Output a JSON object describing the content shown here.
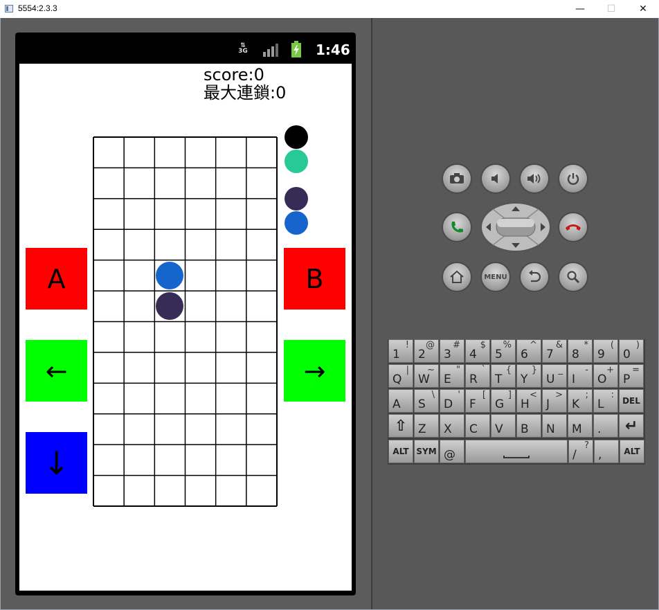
{
  "window": {
    "title": "5554:2.3.3",
    "minimize": "—",
    "maximize": "☐",
    "close": "✕"
  },
  "statusbar": {
    "network": "3G",
    "time": "1:46"
  },
  "game": {
    "score_label": "score:0",
    "max_chain_label": "最大連鎖:0",
    "board": {
      "cols": 6,
      "rows": 12,
      "pieces": [
        {
          "col": 2,
          "row": 4,
          "color": "#1565cc"
        },
        {
          "col": 2,
          "row": 5,
          "color": "#372c55"
        }
      ]
    },
    "next_pieces": [
      {
        "color": "#000000"
      },
      {
        "color": "#27c996"
      },
      {
        "color": "#372c55"
      },
      {
        "color": "#1565cc"
      }
    ],
    "buttons": {
      "a": "A",
      "b": "B",
      "left": "←",
      "right": "→",
      "down": "↓"
    },
    "colors": {
      "a": "#ff0000",
      "b": "#ff0000",
      "left": "#00ff00",
      "right": "#00ff00",
      "down": "#0000ff"
    }
  },
  "hardware": {
    "icons": [
      "camera-icon",
      "volume-down-icon",
      "volume-up-icon",
      "power-icon",
      "call-icon",
      "dpad",
      "end-call-icon",
      "home-icon",
      "menu-icon",
      "back-icon",
      "search-icon"
    ],
    "menu_label": "MENU"
  },
  "keyboard": {
    "rows": [
      [
        {
          "m": "1",
          "s": "!"
        },
        {
          "m": "2",
          "s": "@"
        },
        {
          "m": "3",
          "s": "#"
        },
        {
          "m": "4",
          "s": "$"
        },
        {
          "m": "5",
          "s": "%"
        },
        {
          "m": "6",
          "s": "^"
        },
        {
          "m": "7",
          "s": "&"
        },
        {
          "m": "8",
          "s": "*"
        },
        {
          "m": "9",
          "s": "("
        },
        {
          "m": "0",
          "s": ")"
        }
      ],
      [
        {
          "m": "Q",
          "s": "|"
        },
        {
          "m": "W",
          "s": "~"
        },
        {
          "m": "E",
          "s": "\""
        },
        {
          "m": "R",
          "s": "`"
        },
        {
          "m": "T",
          "s": "{"
        },
        {
          "m": "Y",
          "s": "}"
        },
        {
          "m": "U",
          "s": "_"
        },
        {
          "m": "I",
          "s": "-"
        },
        {
          "m": "O",
          "s": "+"
        },
        {
          "m": "P",
          "s": "="
        }
      ],
      [
        {
          "m": "A",
          "s": ""
        },
        {
          "m": "S",
          "s": "\\"
        },
        {
          "m": "D",
          "s": "'"
        },
        {
          "m": "F",
          "s": "["
        },
        {
          "m": "G",
          "s": "]"
        },
        {
          "m": "H",
          "s": "<"
        },
        {
          "m": "J",
          "s": ">"
        },
        {
          "m": "K",
          "s": ";"
        },
        {
          "m": "L",
          "s": ":"
        },
        {
          "m": "",
          "s": "",
          "c": "DEL"
        }
      ],
      [
        {
          "m": "",
          "s": "",
          "c": "⇧"
        },
        {
          "m": "Z",
          "s": ""
        },
        {
          "m": "X",
          "s": ""
        },
        {
          "m": "C",
          "s": ""
        },
        {
          "m": "V",
          "s": ""
        },
        {
          "m": "B",
          "s": ""
        },
        {
          "m": "N",
          "s": ""
        },
        {
          "m": "M",
          "s": ""
        },
        {
          "m": ".",
          "s": ""
        },
        {
          "m": "",
          "s": "",
          "c": "↵"
        }
      ],
      [
        {
          "m": "",
          "s": "",
          "c": "ALT"
        },
        {
          "m": "",
          "s": "",
          "c": "SYM"
        },
        {
          "m": "@",
          "s": ""
        },
        {
          "m": "",
          "s": "",
          "c": "space"
        },
        {
          "m": "/",
          "s": "?"
        },
        {
          "m": ",",
          "s": ""
        },
        {
          "m": "",
          "s": "",
          "c": "ALT"
        }
      ]
    ]
  }
}
